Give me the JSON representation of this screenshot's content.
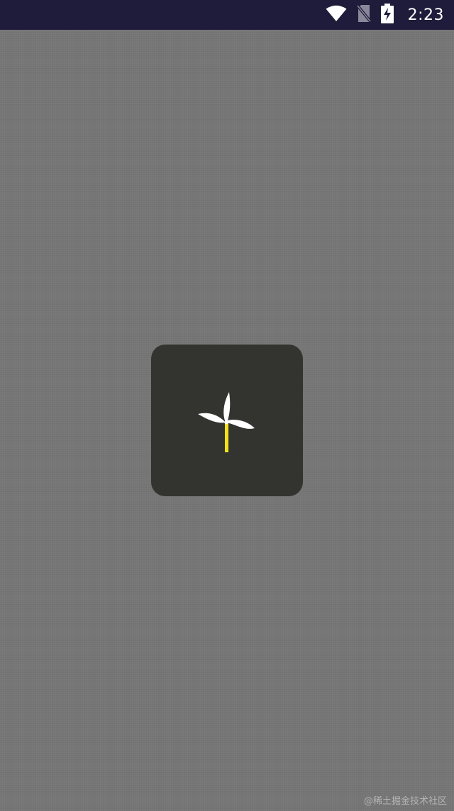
{
  "status_bar": {
    "time": "2:23",
    "icons": [
      "wifi-icon",
      "no-sim-icon",
      "battery-charging-icon"
    ],
    "background": "#1f1b3a"
  },
  "screen": {
    "background": "#767676"
  },
  "loading_card": {
    "background": "#333330",
    "icon": "windmill-icon",
    "blade_color": "#ffffff",
    "pole_color": "#f2e11a"
  },
  "watermark": {
    "text": "@稀土掘金技术社区"
  }
}
